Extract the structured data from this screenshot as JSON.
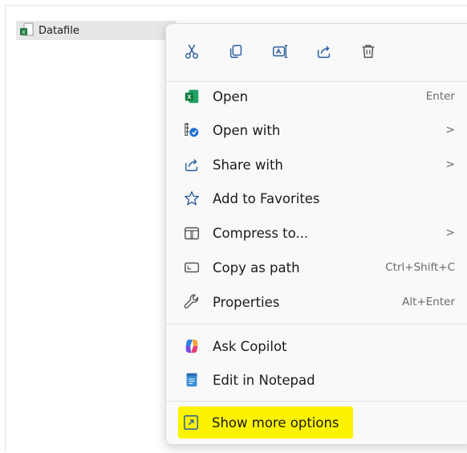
{
  "file": {
    "name": "Datafile",
    "icon": "excel-file-icon"
  },
  "toolbar": [
    {
      "name": "cut",
      "icon": "scissors-icon"
    },
    {
      "name": "copy",
      "icon": "copy-icon"
    },
    {
      "name": "rename",
      "icon": "rename-icon"
    },
    {
      "name": "share",
      "icon": "share-icon"
    },
    {
      "name": "delete",
      "icon": "trash-icon"
    }
  ],
  "menu": {
    "items": [
      {
        "label": "Open",
        "hint": "Enter",
        "icon": "excel-icon"
      },
      {
        "label": "Open with",
        "hint": "",
        "submenu": ">",
        "icon": "open-with-icon"
      },
      {
        "label": "Share with",
        "hint": "",
        "submenu": ">",
        "icon": "share-icon"
      },
      {
        "label": "Add to Favorites",
        "hint": "",
        "icon": "star-icon"
      },
      {
        "label": "Compress to...",
        "hint": "",
        "submenu": ">",
        "icon": "zip-folder-icon"
      },
      {
        "label": "Copy as path",
        "hint": "Ctrl+Shift+C",
        "icon": "path-icon"
      },
      {
        "label": "Properties",
        "hint": "Alt+Enter",
        "icon": "wrench-icon"
      },
      {
        "label": "Ask Copilot",
        "hint": "",
        "icon": "copilot-icon"
      },
      {
        "label": "Edit in Notepad",
        "hint": "",
        "icon": "notepad-icon"
      },
      {
        "label": "Show more options",
        "hint": "",
        "icon": "expand-icon"
      }
    ]
  },
  "colors": {
    "highlight": "#fbf300",
    "accent": "#0a64c8",
    "excel_green": "#1d7a45"
  }
}
